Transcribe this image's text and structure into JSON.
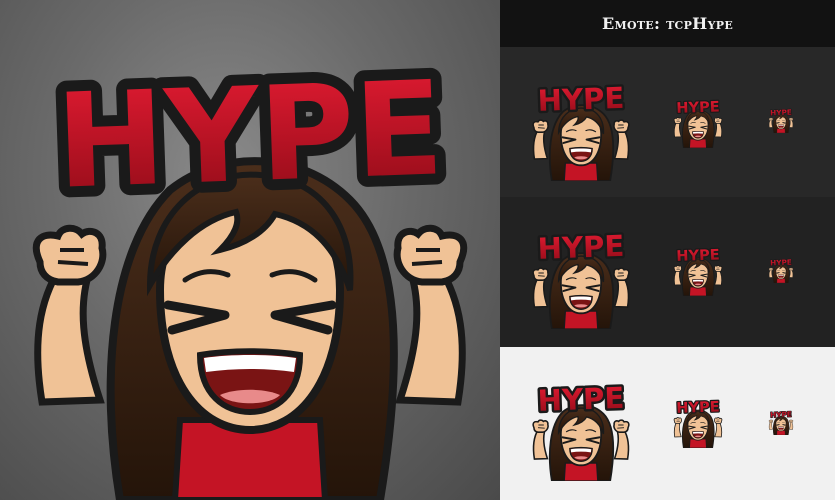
{
  "header": {
    "title": "Emote: tcpHype"
  },
  "emote": {
    "text": "HYPE",
    "icon": "hype-girl-emote"
  },
  "preview": {
    "backgrounds": [
      "dark",
      "darker",
      "light"
    ],
    "sizes": [
      "large",
      "medium",
      "small"
    ]
  },
  "colors": {
    "hype_red": "#d8172e",
    "hype_red_dark": "#8e0b17",
    "hair": "#3a2416",
    "skin": "#f0c296",
    "outline": "#1a1a1a"
  }
}
